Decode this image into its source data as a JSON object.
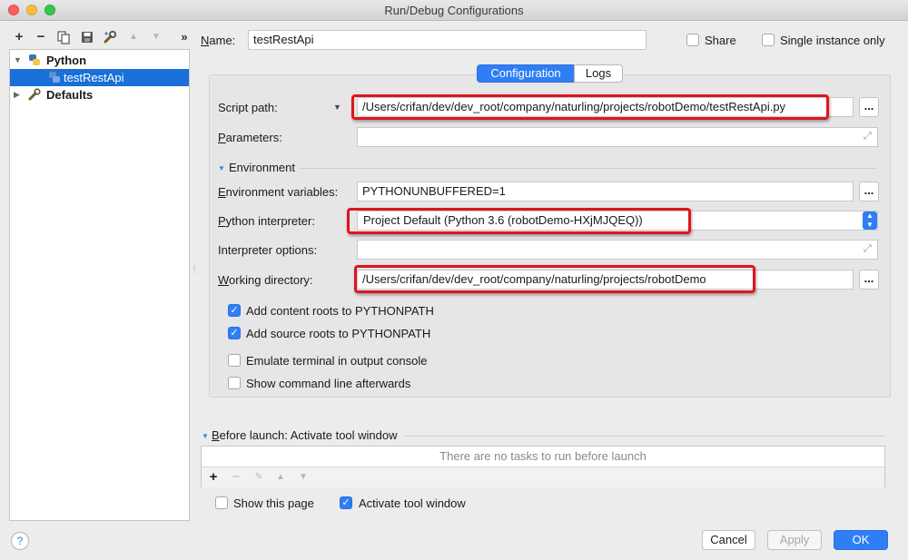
{
  "window": {
    "title": "Run/Debug Configurations"
  },
  "toolbar": {
    "add": "+",
    "remove": "−",
    "more": "»"
  },
  "tree": {
    "items": [
      {
        "label": "Python",
        "expanded": true
      },
      {
        "label": "testRestApi",
        "selected": true
      },
      {
        "label": "Defaults",
        "expanded": false
      }
    ]
  },
  "name_field": {
    "label_prefix": "N",
    "label_rest": "ame:",
    "value": "testRestApi"
  },
  "share": {
    "label": "Share",
    "checked": false
  },
  "single_instance": {
    "label": "Single instance only",
    "checked": false
  },
  "tabs": [
    {
      "label": "Configuration",
      "active": true
    },
    {
      "label": "Logs",
      "active": false
    }
  ],
  "script_path": {
    "label": "Script path:",
    "value": "/Users/crifan/dev/dev_root/company/naturling/projects/robotDemo/testRestApi.py",
    "button": "..."
  },
  "parameters": {
    "label_prefix": "P",
    "label_rest": "arameters:",
    "value": ""
  },
  "environment_section": {
    "label": "Environment"
  },
  "env_vars": {
    "label_prefix": "E",
    "label_rest": "nvironment variables:",
    "value": "PYTHONUNBUFFERED=1",
    "button": "..."
  },
  "interpreter": {
    "label_prefix": "P",
    "label_rest": "ython interpreter:",
    "value": "Project Default (Python 3.6 (robotDemo-HXjMJQEQ))"
  },
  "interpreter_options": {
    "label": "Interpreter options:",
    "value": ""
  },
  "working_dir": {
    "label_prefix": "W",
    "label_rest": "orking directory:",
    "value": "/Users/crifan/dev/dev_root/company/naturling/projects/robotDemo",
    "button": "..."
  },
  "checks": [
    {
      "label": "Add content roots to PYTHONPATH",
      "checked": true
    },
    {
      "label": "Add source roots to PYTHONPATH",
      "checked": true
    },
    {
      "label": "Emulate terminal in output console",
      "checked": false
    },
    {
      "label": "Show command line afterwards",
      "checked": false
    }
  ],
  "before_launch": {
    "label_prefix": "B",
    "label_rest": "efore launch: Activate tool window",
    "empty_text": "There are no tasks to run before launch",
    "add": "+",
    "remove": "−"
  },
  "show_page": {
    "label": "Show this page",
    "checked": false
  },
  "activate_tool": {
    "label": "Activate tool window",
    "checked": true
  },
  "buttons": {
    "cancel": "Cancel",
    "apply": "Apply",
    "ok": "OK",
    "help": "?"
  },
  "colors": {
    "accent": "#2f7ef6",
    "highlight": "#e0141e",
    "selection": "#1a6fd8"
  }
}
